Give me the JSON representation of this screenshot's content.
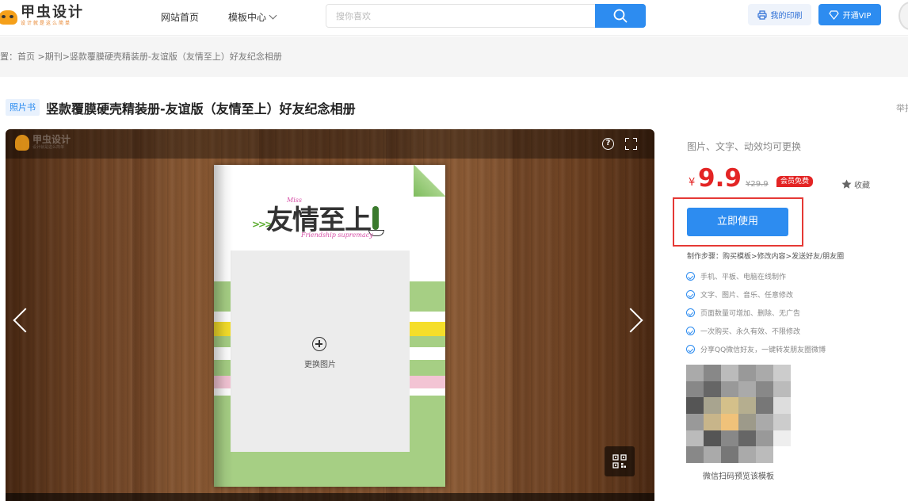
{
  "header": {
    "logo_text": "甲虫设计",
    "logo_slogan": "设计就是这么简单",
    "nav_home": "网站首页",
    "nav_templates": "模板中心",
    "search_placeholder": "搜你喜欢",
    "print_label": "我的印刷",
    "vip_label": "开通VIP"
  },
  "breadcrumb": "置：首页 >期刊>竖款覆膜硬壳精装册-友谊版（友情至上）好友纪念相册",
  "product": {
    "tag": "照片书",
    "title": "竖款覆膜硬壳精装册-友谊版（友情至上）好友纪念相册",
    "edge_text": "举报"
  },
  "preview": {
    "watermark": "甲虫设计",
    "watermark_slogan": "设计就是这么简单",
    "replace_label": "更换图片",
    "album_title": "友情至上",
    "album_script": "Friendship supremacy",
    "album_miss": "Miss"
  },
  "panel": {
    "subtitle": "图片、文字、动效均可更换",
    "currency": "¥",
    "price": "9.9",
    "original_price": "¥29.9",
    "vip_free": "会员免费",
    "favorite": "收藏",
    "use_button": "立即使用",
    "steps": "制作步骤：购买模板>修改内容>发送好友/朋友圈",
    "features": [
      "手机、平板、电脑在线制作",
      "文字、图片、音乐、任意修改",
      "页面数量可增加、删除、无广告",
      "一次购买、永久有效、不限修改",
      "分享QQ微信好友，一键转发朋友圈微博"
    ],
    "qr_caption": "微信扫码预览该模板"
  },
  "colors": {
    "accent": "#2d8cf0",
    "price_red": "#e32424",
    "highlight_frame": "#e53935"
  }
}
